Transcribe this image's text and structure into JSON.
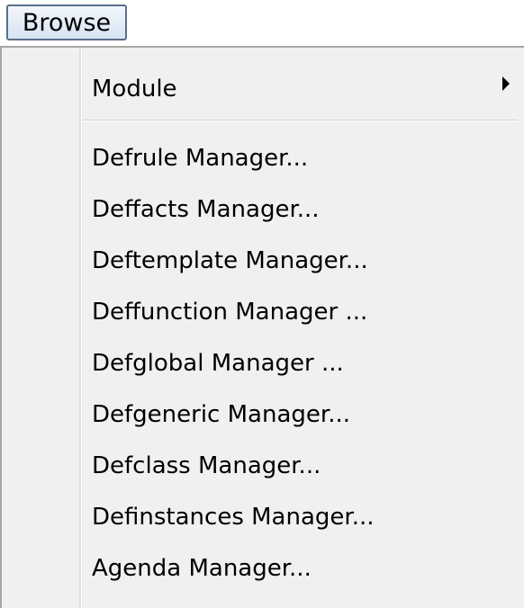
{
  "menubar": {
    "browse_label": "Browse"
  },
  "menu": {
    "submenu_item": {
      "label": "Module"
    },
    "items": [
      {
        "label": "Defrule Manager..."
      },
      {
        "label": "Deffacts Manager..."
      },
      {
        "label": "Deftemplate Manager..."
      },
      {
        "label": "Deffunction Manager ..."
      },
      {
        "label": "Defglobal Manager ..."
      },
      {
        "label": "Defgeneric Manager..."
      },
      {
        "label": "Defclass Manager..."
      },
      {
        "label": "Definstances Manager..."
      },
      {
        "label": "Agenda Manager..."
      }
    ]
  }
}
